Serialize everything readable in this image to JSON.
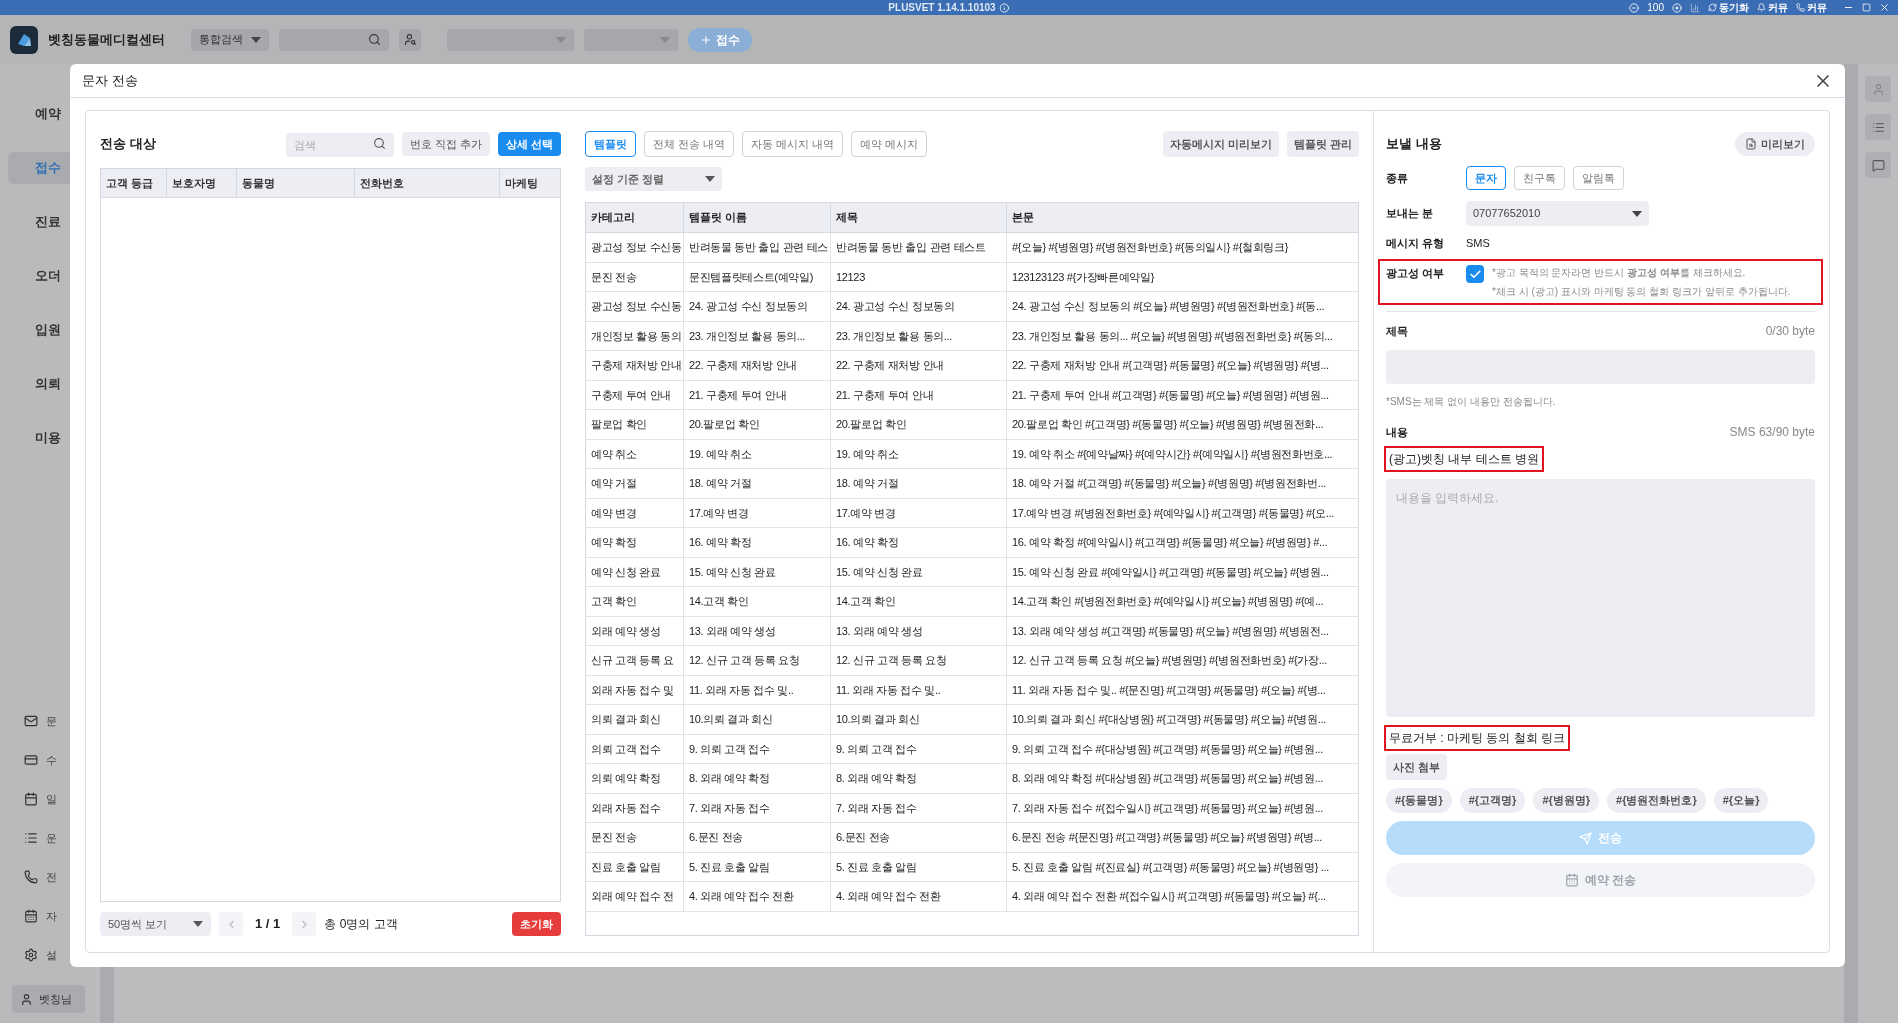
{
  "top_bar": {
    "title": "PLUSVET 1.14.1.10103",
    "zoom": "100",
    "actions": [
      {
        "label": "동기화",
        "kind": "sync"
      },
      {
        "label": "커뮤",
        "kind": "bell"
      },
      {
        "label": "커뮤",
        "kind": "phone"
      }
    ]
  },
  "header": {
    "clinic_name": "벳칭동물메디컬센터",
    "search_scope": "통합검색",
    "register_button": "접수"
  },
  "sidebar": {
    "items": [
      {
        "label": "예약",
        "selected": false
      },
      {
        "label": "접수",
        "selected": true
      },
      {
        "label": "진료",
        "selected": false
      },
      {
        "label": "오더",
        "selected": false
      },
      {
        "label": "입원",
        "selected": false
      },
      {
        "label": "의뢰",
        "selected": false
      },
      {
        "label": "미용",
        "selected": false
      }
    ],
    "tools": [
      {
        "label": "문",
        "kind": "mail"
      },
      {
        "label": "수",
        "kind": "card"
      },
      {
        "label": "일",
        "kind": "calendar"
      },
      {
        "label": "운",
        "kind": "list"
      },
      {
        "label": "전",
        "kind": "phone"
      },
      {
        "label": "자",
        "kind": "date"
      },
      {
        "label": "설",
        "kind": "settings"
      }
    ],
    "user": "벳칭님"
  },
  "dialog": {
    "title": "문자 전송",
    "recipients": {
      "title": "전송 대상",
      "search_placeholder": "검색",
      "add_button": "번호 직접 추가",
      "detail_button": "상세 선택",
      "columns": [
        "고객 등급",
        "보호자명",
        "동물명",
        "전화번호",
        "마케팅"
      ],
      "page_size": "50명씩 보기",
      "page": "1 / 1",
      "total": "총 0명의 고객",
      "reset_button": "초기화"
    },
    "templates": {
      "tabs": [
        {
          "label": "템플릿",
          "selected": true
        },
        {
          "label": "전체 전송 내역",
          "selected": false
        },
        {
          "label": "자동 메시지 내역",
          "selected": false
        },
        {
          "label": "예약 메시지",
          "selected": false
        }
      ],
      "actions": [
        "자동메시지 미리보기",
        "템플릿 관리"
      ],
      "sort": "설정 기준 정렬",
      "columns": [
        "카테고리",
        "템플릿 이름",
        "제목",
        "본문"
      ],
      "rows": [
        [
          "광고성 정보 수신동",
          "반려동물 동반 출입 관련 테스",
          "반려동물 동반 출입 관련 테스트",
          "#{오늘} #{병원명} #{병원전화번호} #{동의일시} #{철회링크}"
        ],
        [
          "문진 전송",
          "문진템플릿테스트(예약일)",
          "12123",
          "123123123 #{가장빠른예약일}"
        ],
        [
          "광고성 정보 수신동",
          "24. 광고성 수신 정보동의",
          "24. 광고성 수신 정보동의",
          "24. 광고성 수신 정보동의 #{오늘} #{병원명} #{병원전화번호} #{동..."
        ],
        [
          "개인정보 활용 동의",
          "23. 개인정보 활용 동의...",
          "23. 개인정보 활용 동의...",
          "23. 개인정보 활용 동의... #{오늘} #{병원명} #{병원전화번호} #{동의..."
        ],
        [
          "구충제 재처방 안내",
          "22. 구충제 재처방 안내",
          "22. 구충제 재처방 안내",
          "22. 구충제 재처방 안내 #{고객명} #{동물명} #{오늘} #{병원명} #{병..."
        ],
        [
          "구충제 투여 안내",
          "21. 구충제 투여 안내",
          "21. 구충제 투여 안내",
          "21. 구충제 투여 안내 #{고객명} #{동물명} #{오늘} #{병원명} #{병원..."
        ],
        [
          "팔로업 확인",
          "20.팔로업 확인",
          "20.팔로업 확인",
          "20.팔로업 확인 #{고객명} #{동물명} #{오늘} #{병원명} #{병원전화..."
        ],
        [
          "예약 취소",
          "19. 예약 취소",
          "19. 예약 취소",
          "19. 예약 취소 #{예약날짜} #{예약시간} #{예약일시} #{병원전화번호..."
        ],
        [
          "예약 거절",
          "18. 예약 거절",
          "18. 예약 거절",
          "18. 예약 거절 #{고객명} #{동물명} #{오늘} #{병원명} #{병원전화번..."
        ],
        [
          "예약 변경",
          "17.예약 변경",
          "17.예약 변경",
          "17.예약 변경 #{병원전화번호} #{예약일시} #{고객명} #{동물명} #{오..."
        ],
        [
          "예약 확정",
          "16. 예약 확정",
          "16. 예약 확정",
          "16. 예약 확정 #{예약일시} #{고객명} #{동물명} #{오늘} #{병원명} #..."
        ],
        [
          "예약 신청 완료",
          "15. 예약 신청 완료",
          "15. 예약 신청 완료",
          "15. 예약 신청 완료 #{예약일시} #{고객명} #{동물명} #{오늘} #{병원..."
        ],
        [
          "고객 확인",
          "14.고객 확인",
          "14.고객 확인",
          "14.고객 확인 #{병원전화번호} #{예약일시} #{오늘} #{병원명} #{예..."
        ],
        [
          "외래 예약 생성",
          "13. 외래 예약 생성",
          "13. 외래 예약 생성",
          "13. 외래 예약 생성 #{고객명} #{동물명} #{오늘} #{병원명} #{병원전..."
        ],
        [
          "신규 고객 등록 요",
          "12. 신규 고객 등록 요청",
          "12. 신규 고객 등록 요청",
          "12. 신규 고객 등록 요청 #{오늘} #{병원명} #{병원전화번호} #{가장..."
        ],
        [
          "외래 자동 접수 및",
          "11. 외래 자동 접수 및..",
          "11. 외래 자동 접수 및..",
          "11. 외래 자동 접수 및.. #{문진명} #{고객명} #{동물명} #{오늘} #{병..."
        ],
        [
          "의뢰 결과 회신",
          "10.의뢰 결과 회신",
          "10.의뢰 결과 회신",
          "10.의뢰 결과 회신 #{대상병원} #{고객명} #{동물명} #{오늘} #{병원..."
        ],
        [
          "의뢰 고객 접수",
          "9. 의뢰 고객 접수",
          "9. 의뢰 고객 접수",
          "9. 의뢰 고객 접수 #{대상병원} #{고객명} #{동물명} #{오늘} #{병원..."
        ],
        [
          "의뢰 예약 확정",
          "8. 외래 예약 확정",
          "8. 외래 예약 확정",
          "8. 외래 예약 확정 #{대상병원} #{고객명} #{동물명} #{오늘} #{병원..."
        ],
        [
          "외래 자동 접수",
          "7. 외래 자동 접수",
          "7. 외래 자동 접수",
          "7. 외래 자동 접수 #{접수일시} #{고객명} #{동물명} #{오늘} #{병원..."
        ],
        [
          "문진 전송",
          "6.문진 전송",
          "6.문진 전송",
          "6.문진 전송 #{문진명} #{고객명} #{동물명} #{오늘} #{병원명} #{병..."
        ],
        [
          "진료 호출 알림",
          "5. 진료 호출 알림",
          "5. 진료 호출 알림",
          "5. 진료 호출 알림 #{진료실} #{고객명} #{동물명} #{오늘} #{병원명} ..."
        ],
        [
          "외래 예약 접수 전",
          "4. 외래 예약 접수 전환",
          "4. 외래 예약 접수 전환",
          "4. 외래 예약 접수 전환 #{접수일시} #{고객명} #{동물명} #{오늘} #{..."
        ]
      ]
    },
    "compose": {
      "title": "보낼 내용",
      "preview_button": "미리보기",
      "type_label": "종류",
      "types": [
        {
          "label": "문자",
          "selected": true
        },
        {
          "label": "친구톡",
          "selected": false
        },
        {
          "label": "알림톡",
          "selected": false
        }
      ],
      "sender_label": "보내는 분",
      "sender": "07077652010",
      "message_type_label": "메시지 유형",
      "message_type": "SMS",
      "ad": {
        "label": "광고성 여부",
        "checked": true,
        "highlighted": true,
        "notes": [
          "*광고 목적의 문자라면 반드시 **광고성 여부**를 체크하세요.",
          "*체크 시 (광고) 표시와 마케팅 동의 철회 링크가 앞뒤로 추가됩니다."
        ]
      },
      "subject": {
        "label": "제목",
        "counter": "0/30 byte"
      },
      "sms_note": "*SMS는 제목 없이 내용만 전송됩니다.",
      "content": {
        "label": "내용",
        "counter": "SMS 63/90 byte",
        "placeholder": "내용을 입력하세요."
      },
      "prefix": {
        "text": "(광고)벳칭 내부 테스트 병원",
        "highlighted": true
      },
      "suffix": {
        "text": "무료거부 : 마케팅 동의 철회 링크",
        "highlighted": true
      },
      "attach_button": "사진 첨부",
      "variables": [
        "#{동물명}",
        "#{고객명}",
        "#{병원명}",
        "#{병원전화번호}",
        "#{오늘}"
      ],
      "send_button": {
        "label": "전송",
        "disabled": true
      },
      "schedule_button": {
        "label": "예약 전송",
        "disabled": true
      }
    }
  }
}
